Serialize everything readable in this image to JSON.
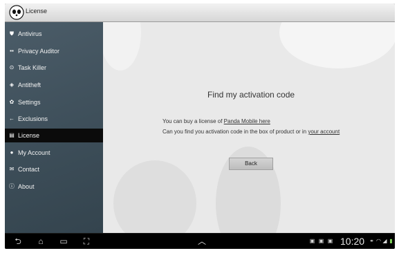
{
  "window": {
    "title": "License",
    "logo": "panda-logo"
  },
  "sidebar": {
    "items": [
      {
        "label": "Antivirus",
        "icon": "shield-icon"
      },
      {
        "label": "Privacy Auditor",
        "icon": "grid-icon"
      },
      {
        "label": "Task Killer",
        "icon": "circle-icon"
      },
      {
        "label": "Antitheft",
        "icon": "diamond-icon"
      },
      {
        "label": "Settings",
        "icon": "gear-icon"
      },
      {
        "label": "Exclusions",
        "icon": "arrow-left-icon"
      },
      {
        "label": "License",
        "icon": "document-icon",
        "active": true
      },
      {
        "label": "My Account",
        "icon": "person-icon"
      },
      {
        "label": "Contact",
        "icon": "envelope-icon"
      },
      {
        "label": "About",
        "icon": "info-icon"
      }
    ]
  },
  "main": {
    "heading": "Find my activation code",
    "line1_prefix": "You can buy a license of ",
    "line1_link": "Panda Mobile here",
    "line2_prefix": "Can you find you activation code in the box of product or in ",
    "line2_link": "your account",
    "back_label": "Back"
  },
  "statusbar": {
    "time": "10:20",
    "icons": [
      "gallery-icon",
      "download-icon",
      "briefcase-icon",
      "usb-icon",
      "wifi-icon",
      "signal-icon",
      "battery-icon"
    ]
  },
  "colors": {
    "sidebar": "#3f505b",
    "content_bg": "#e9e9e9",
    "active_item": "#0b0b0b",
    "navbar": "#000000"
  }
}
